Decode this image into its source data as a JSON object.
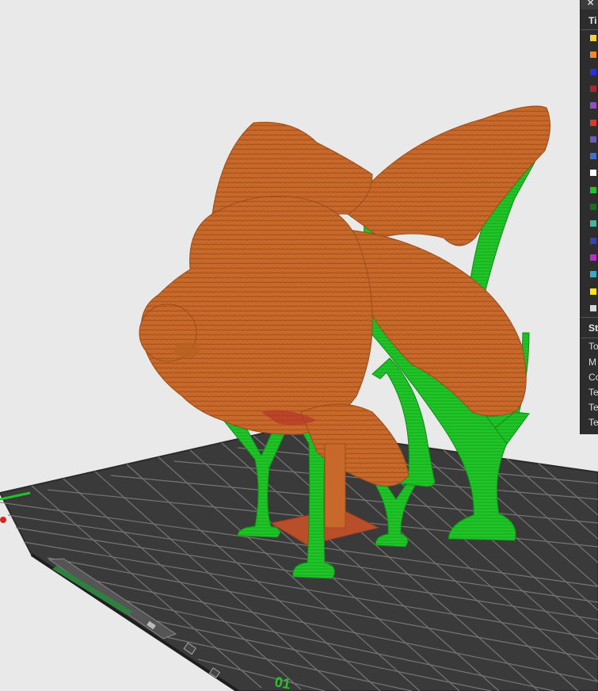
{
  "legend": {
    "close_glyph": "✕",
    "title_label": "Ti",
    "stats_title": "St",
    "stat_labels": [
      "To",
      "M",
      "Co",
      "Te",
      "Te",
      "Te"
    ],
    "swatches": [
      "#f2d13a",
      "#f08a2e",
      "#2431d8",
      "#a32a2a",
      "#8f4fc4",
      "#d9382c",
      "#6a5ab8",
      "#3f70c4",
      "#ffffff",
      "#22c22b",
      "#1e6b22",
      "#3fb8a3",
      "#3346a8",
      "#b530c4",
      "#3aa9c9",
      "#ffe60f",
      "#d8d8d8"
    ]
  },
  "bed": {
    "axis_label": "01",
    "colors": {
      "bed": "#3a3a3a",
      "grid": "#7a7a7a",
      "model": "#c96a2a",
      "model_shadow": "#a8541d",
      "support": "#1fc427",
      "support_dark": "#169a1e",
      "raft": "#b84e2a"
    }
  }
}
